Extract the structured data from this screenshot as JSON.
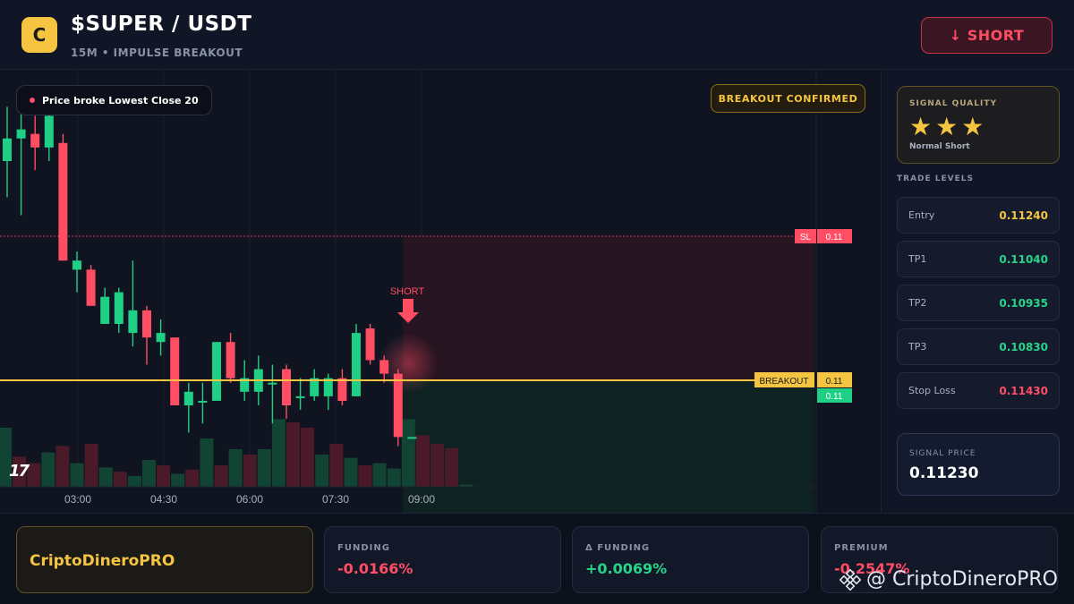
{
  "header": {
    "logo_letter": "C",
    "pair": "$SUPER / USDT",
    "subline": "15M • IMPULSE BREAKOUT",
    "short_button": "↓ SHORT"
  },
  "chart": {
    "badge": "Price broke Lowest Close 20",
    "confirm_badge": "BREAKOUT CONFIRMED",
    "short_marker": "SHORT",
    "sl_tag": "SL",
    "sl_value": "0.11",
    "breakout_tag": "BREAKOUT",
    "breakout_value": "0.11",
    "current_value": "0.11",
    "tv_logo": "17"
  },
  "chart_data": {
    "type": "candlestick",
    "x_ticks": [
      "03:00",
      "04:30",
      "06:00",
      "07:30",
      "09:00"
    ],
    "candles": [
      {
        "o": 0.115,
        "c": 0.1155,
        "h": 0.1162,
        "l": 0.1142,
        "dir": "up"
      },
      {
        "o": 0.1155,
        "c": 0.1157,
        "h": 0.1164,
        "l": 0.1138,
        "dir": "up"
      },
      {
        "o": 0.1156,
        "c": 0.1153,
        "h": 0.116,
        "l": 0.1148,
        "dir": "down"
      },
      {
        "o": 0.1153,
        "c": 0.116,
        "h": 0.1164,
        "l": 0.115,
        "dir": "up"
      },
      {
        "o": 0.1154,
        "c": 0.1128,
        "h": 0.1156,
        "l": 0.1128,
        "dir": "down"
      },
      {
        "o": 0.1128,
        "c": 0.1126,
        "h": 0.113,
        "l": 0.1121,
        "dir": "up"
      },
      {
        "o": 0.1126,
        "c": 0.1118,
        "h": 0.1127,
        "l": 0.1118,
        "dir": "down"
      },
      {
        "o": 0.1114,
        "c": 0.112,
        "h": 0.1122,
        "l": 0.1114,
        "dir": "up"
      },
      {
        "o": 0.1114,
        "c": 0.1121,
        "h": 0.1122,
        "l": 0.1112,
        "dir": "up"
      },
      {
        "o": 0.1117,
        "c": 0.1112,
        "h": 0.1128,
        "l": 0.1109,
        "dir": "up"
      },
      {
        "o": 0.1117,
        "c": 0.1111,
        "h": 0.1118,
        "l": 0.1105,
        "dir": "down"
      },
      {
        "o": 0.1112,
        "c": 0.111,
        "h": 0.1115,
        "l": 0.1107,
        "dir": "up"
      },
      {
        "o": 0.1111,
        "c": 0.1096,
        "h": 0.1111,
        "l": 0.1096,
        "dir": "down"
      },
      {
        "o": 0.1096,
        "c": 0.1099,
        "h": 0.1101,
        "l": 0.109,
        "dir": "up"
      },
      {
        "o": 0.1097,
        "c": 0.1097,
        "h": 0.1101,
        "l": 0.1092,
        "dir": "up"
      },
      {
        "o": 0.1097,
        "c": 0.111,
        "h": 0.111,
        "l": 0.1097,
        "dir": "up"
      },
      {
        "o": 0.111,
        "c": 0.1102,
        "h": 0.1112,
        "l": 0.1101,
        "dir": "down"
      },
      {
        "o": 0.1099,
        "c": 0.1102,
        "h": 0.1106,
        "l": 0.1097,
        "dir": "up"
      },
      {
        "o": 0.1104,
        "c": 0.1099,
        "h": 0.1107,
        "l": 0.1096,
        "dir": "up"
      },
      {
        "o": 0.1101,
        "c": 0.1101,
        "h": 0.1105,
        "l": 0.1092,
        "dir": "up"
      },
      {
        "o": 0.1104,
        "c": 0.1096,
        "h": 0.1105,
        "l": 0.1093,
        "dir": "down"
      },
      {
        "o": 0.1098,
        "c": 0.1098,
        "h": 0.1102,
        "l": 0.1095,
        "dir": "up"
      },
      {
        "o": 0.1098,
        "c": 0.1102,
        "h": 0.1104,
        "l": 0.1097,
        "dir": "up"
      },
      {
        "o": 0.1098,
        "c": 0.1102,
        "h": 0.1103,
        "l": 0.1095,
        "dir": "up"
      },
      {
        "o": 0.1102,
        "c": 0.1097,
        "h": 0.1104,
        "l": 0.1096,
        "dir": "down"
      },
      {
        "o": 0.1098,
        "c": 0.1112,
        "h": 0.1114,
        "l": 0.1098,
        "dir": "up"
      },
      {
        "o": 0.1113,
        "c": 0.1106,
        "h": 0.1114,
        "l": 0.1105,
        "dir": "down"
      },
      {
        "o": 0.1106,
        "c": 0.1103,
        "h": 0.1107,
        "l": 0.1101,
        "dir": "down"
      },
      {
        "o": 0.1103,
        "c": 0.1089,
        "h": 0.1104,
        "l": 0.1087,
        "dir": "down"
      },
      {
        "o": 0.1089,
        "c": 0.1089,
        "h": 0.1089,
        "l": 0.1089,
        "dir": "up"
      }
    ],
    "volumes": [
      0.55,
      0.28,
      0.22,
      0.32,
      0.38,
      0.22,
      0.4,
      0.18,
      0.14,
      0.1,
      0.25,
      0.2,
      0.12,
      0.16,
      0.45,
      0.2,
      0.35,
      0.3,
      0.35,
      0.63,
      0.6,
      0.55,
      0.3,
      0.4,
      0.27,
      0.2,
      0.22,
      0.17,
      0.63,
      0.48,
      0.4,
      0.36,
      0.02
    ],
    "volume_dirs": [
      "up",
      "down",
      "down",
      "up",
      "down",
      "up",
      "down",
      "up",
      "down",
      "up",
      "up",
      "down",
      "up",
      "down",
      "up",
      "down",
      "up",
      "down",
      "up",
      "up",
      "down",
      "down",
      "up",
      "down",
      "up",
      "down",
      "up",
      "up",
      "up",
      "down",
      "down",
      "down",
      "up"
    ],
    "y_range": [
      0.1078,
      0.1168
    ],
    "sl_level": 0.1143,
    "breakout_level": 0.109,
    "grid": true
  },
  "sidebar": {
    "quality_title": "SIGNAL QUALITY",
    "stars": "★★★",
    "star_count": 3,
    "quality_sub": "Normal Short",
    "levels_title": "TRADE LEVELS",
    "levels": [
      {
        "label": "Entry",
        "value": "0.11240",
        "color": "#f5c542"
      },
      {
        "label": "TP1",
        "value": "0.11040",
        "color": "#26d48a"
      },
      {
        "label": "TP2",
        "value": "0.10935",
        "color": "#26d48a"
      },
      {
        "label": "TP3",
        "value": "0.10830",
        "color": "#26d48a"
      },
      {
        "label": "Stop Loss",
        "value": "0.11430",
        "color": "#ff4d64"
      }
    ],
    "signal_price_label": "SIGNAL PRICE",
    "signal_price": "0.11230"
  },
  "footer": {
    "brand": "CriptoDineroPRO",
    "stats": [
      {
        "label": "FUNDING",
        "value": "-0.0166%",
        "color": "#ff4d64"
      },
      {
        "label": "Δ FUNDING",
        "value": "+0.0069%",
        "color": "#26d48a"
      },
      {
        "label": "PREMIUM",
        "value": "-0.2547%",
        "color": "#ff4d64"
      }
    ],
    "watermark": "@ CriptoDineroPRO"
  },
  "colors": {
    "up": "#1fcf85",
    "down": "#ff4d64",
    "accent": "#f5c542"
  }
}
